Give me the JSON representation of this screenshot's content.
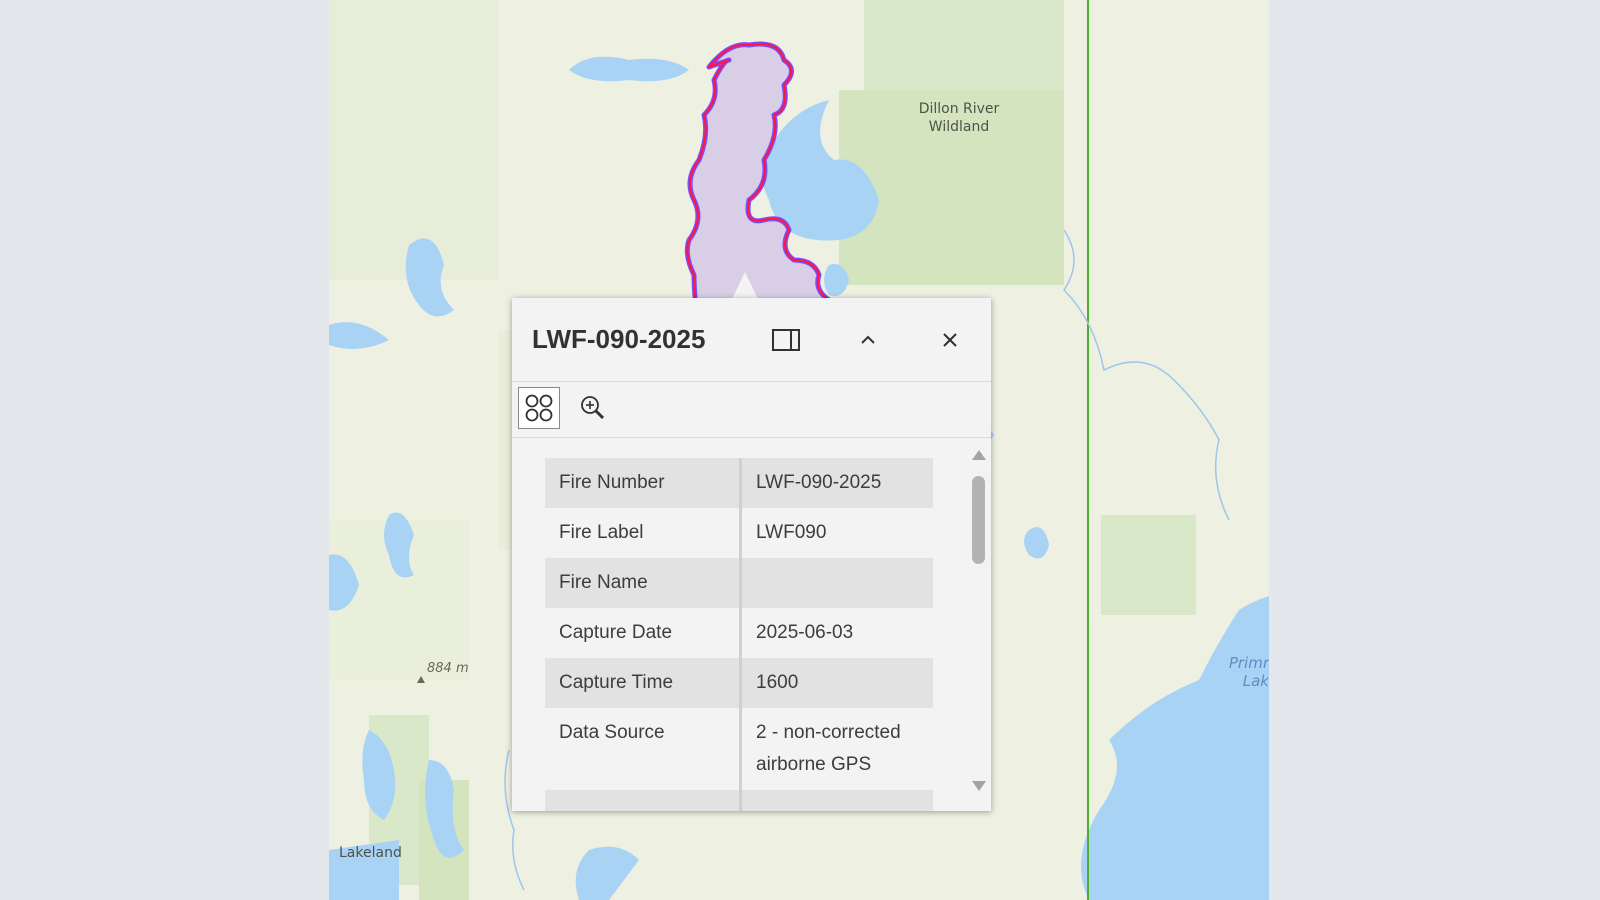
{
  "map": {
    "labels": {
      "wildland": "Dillon River\nWildland",
      "lakeland": "Lakeland",
      "elevation": "884 m",
      "primrose": "Primr\nLak"
    },
    "colors": {
      "land": "#eef0e2",
      "water": "#a9d3f5",
      "park": "#cfe2bc",
      "boundary": "#4caf30",
      "fire_fill": "#d8cfe6",
      "fire_outline_red": "#ff1744",
      "fire_outline_blue": "#7c4dff"
    }
  },
  "popup": {
    "title": "LWF-090-2025",
    "buttons": {
      "dock": "dock-icon",
      "collapse": "chevron-up-icon",
      "close": "close-icon",
      "features": "features-grid-icon",
      "zoom": "zoom-to-icon"
    },
    "attributes": [
      {
        "key": "Fire Number",
        "value": "LWF-090-2025"
      },
      {
        "key": "Fire Label",
        "value": "LWF090"
      },
      {
        "key": "Fire Name",
        "value": ""
      },
      {
        "key": "Capture Date",
        "value": "2025-06-03"
      },
      {
        "key": "Capture Time",
        "value": "1600"
      },
      {
        "key": "Data Source",
        "value": "2 - non-corrected airborne GPS"
      }
    ]
  }
}
